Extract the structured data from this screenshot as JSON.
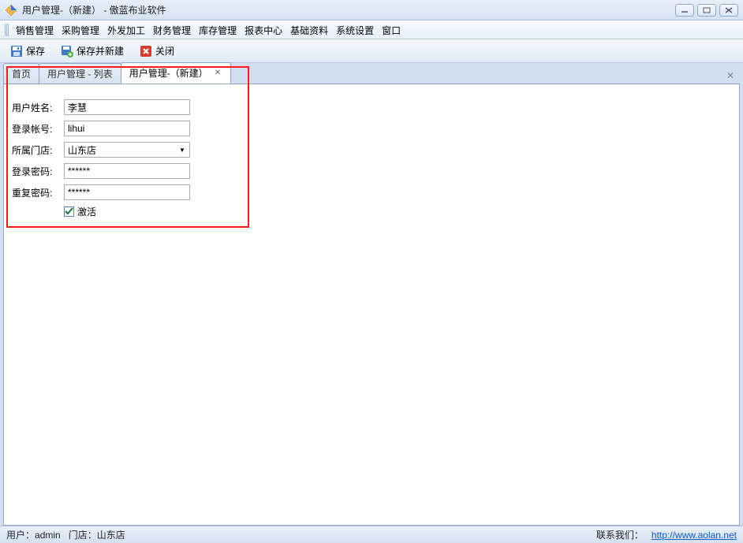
{
  "title": "用户管理-（新建） - 傲蓝布业软件",
  "window_controls": {
    "min": "—",
    "max": "❐",
    "close": "✕"
  },
  "menu": [
    "销售管理",
    "采购管理",
    "外发加工",
    "财务管理",
    "库存管理",
    "报表中心",
    "基础资料",
    "系统设置",
    "窗口"
  ],
  "toolbar": {
    "save": "保存",
    "save_new": "保存并新建",
    "close": "关闭"
  },
  "tabs": [
    {
      "label": "首页",
      "closable": false
    },
    {
      "label": "用户管理 - 列表",
      "closable": false
    },
    {
      "label": "用户管理-（新建）",
      "closable": true,
      "active": true
    }
  ],
  "tabs_close_all": "✕",
  "form": {
    "labels": {
      "username": "用户姓名:",
      "account": "登录帐号:",
      "store": "所属门店:",
      "password": "登录密码:",
      "repeat_password": "重复密码:",
      "active": "激活"
    },
    "values": {
      "username": "李慧",
      "account": "lihui",
      "store": "山东店",
      "password": "******",
      "repeat_password": "******",
      "active_checked": true
    }
  },
  "status": {
    "user_label": "用户：",
    "user_value": "admin",
    "store_label": "门店：",
    "store_value": "山东店",
    "contact_label": "联系我们：",
    "contact_url": "http://www.aolan.net"
  }
}
